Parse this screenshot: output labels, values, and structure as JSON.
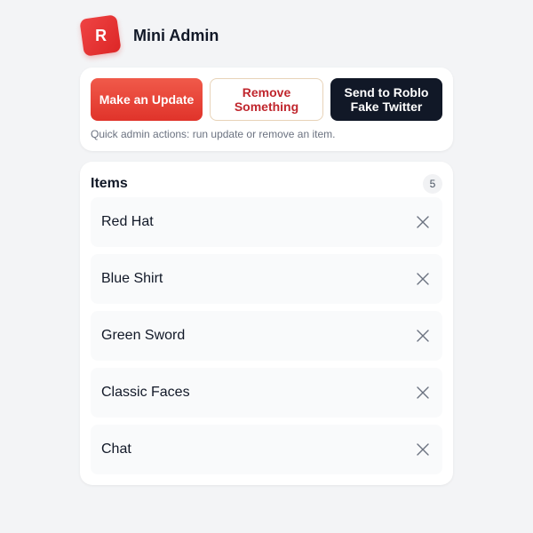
{
  "header": {
    "logo_letter": "R",
    "title": "Mini Admin",
    "logo_color": "#e5392f"
  },
  "actions": {
    "make_update_label": "Make an Update",
    "remove_something_label": "Remove Something",
    "send_label": "Send to Roblo Fake Twitter",
    "hint": "Quick admin actions: run update or remove an item."
  },
  "items": {
    "title": "Items",
    "count": "5",
    "list": [
      {
        "label": "Red Hat",
        "remove_icon": "close-icon"
      },
      {
        "label": "Blue Shirt",
        "remove_icon": "close-icon"
      },
      {
        "label": "Green Sword",
        "remove_icon": "close-icon"
      },
      {
        "label": "Classic Faces",
        "remove_icon": "close-icon"
      },
      {
        "label": "Chat",
        "remove_icon": "close-icon"
      }
    ]
  },
  "colors": {
    "accent": "#e5392f",
    "dark": "#111827",
    "background": "#f3f4f6"
  }
}
